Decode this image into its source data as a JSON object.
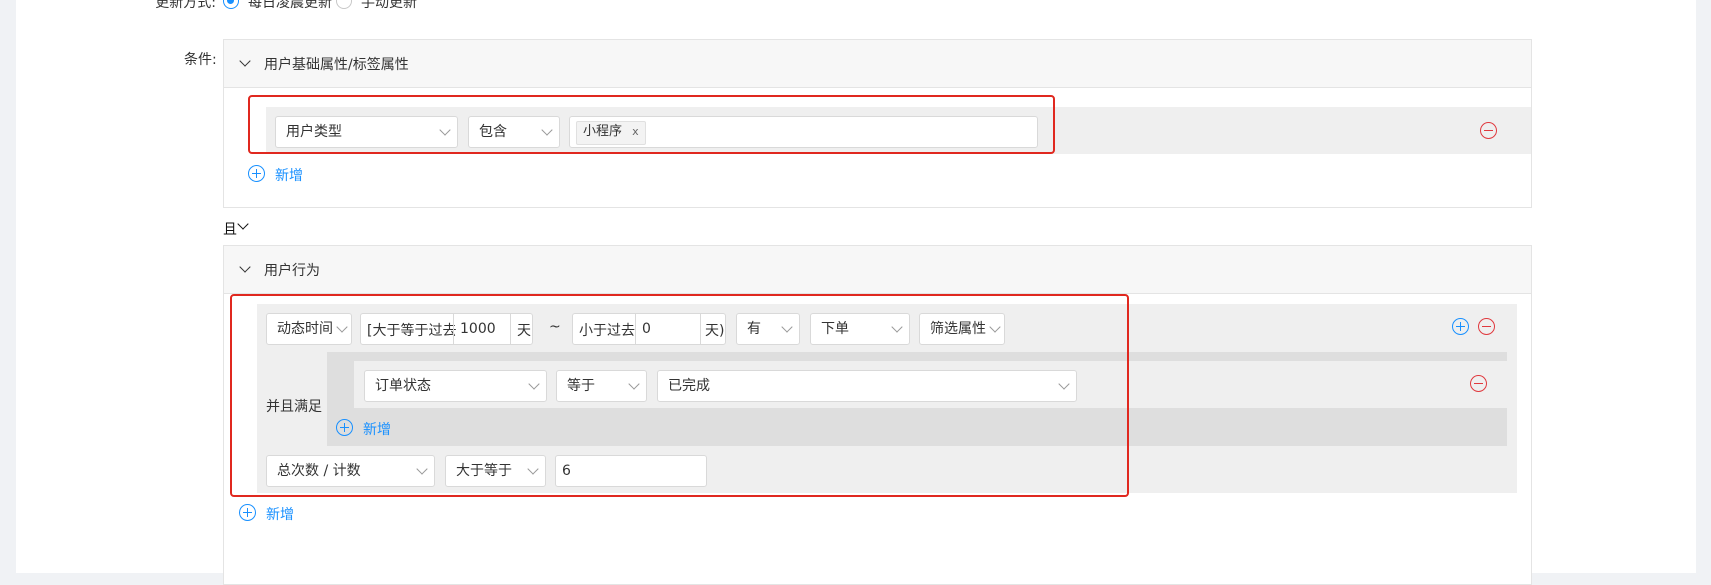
{
  "update": {
    "label": "更新方式:",
    "options": [
      {
        "label": "每日凌晨更新",
        "checked": true
      },
      {
        "label": "手动更新",
        "checked": false
      }
    ]
  },
  "conditions_label": "条件:",
  "basic_panel": {
    "title": "用户基础属性/标签属性",
    "row": {
      "field": "用户类型",
      "operator": "包含",
      "tags": [
        "小程序"
      ],
      "tag_remove": "x"
    },
    "add_label": "新增"
  },
  "logic": {
    "label": "且"
  },
  "behavior_panel": {
    "title": "用户行为",
    "row": {
      "time_field": "动态时间",
      "range_start_prefix": "[大于等于过去",
      "range_start_value": "1000",
      "range_start_unit": "天",
      "tilde": "~",
      "range_end_prefix": "小于过去",
      "range_end_value": "0",
      "range_end_unit": "天)",
      "has": "有",
      "event": "下单",
      "filter": "筛选属性",
      "and_label": "并且满足",
      "sub_condition": {
        "field": "订单状态",
        "operator": "等于",
        "value": "已完成"
      },
      "sub_add_label": "新增",
      "metric": "总次数 / 计数",
      "metric_operator": "大于等于",
      "metric_value": "6"
    },
    "add_label": "新增"
  },
  "colors": {
    "primary": "#1890ff",
    "danger": "#e0393e",
    "highlight": "#e0281f",
    "panel_head": "#f7f7f7",
    "row_bg": "#efefef",
    "nested_bg": "#dedede"
  }
}
